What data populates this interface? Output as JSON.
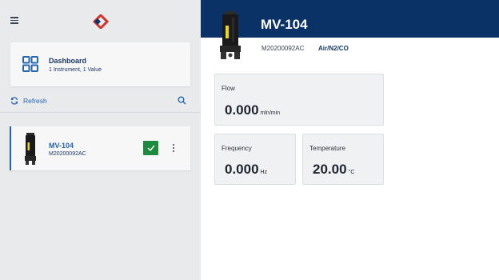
{
  "colors": {
    "brand_navy": "#0a3266",
    "accent_blue": "#2566b0",
    "logo_red": "#d0342c",
    "status_green": "#1e8a3d",
    "sidebar_bg": "#e9eaec"
  },
  "sidebar": {
    "menu_icon": "hamburger-icon",
    "logo_icon": "brand-logo-icon",
    "dashboard": {
      "icon": "grid-icon",
      "title": "Dashboard",
      "subtitle": "1 Instrument, 1 Value"
    },
    "refresh": {
      "icon": "refresh-icon",
      "label": "Refresh"
    },
    "search_icon": "search-icon",
    "instruments": [
      {
        "name": "MV-104",
        "serial": "M20200092AC",
        "status_icon": "checkmark-icon",
        "menu_icon": "kebab-icon"
      }
    ]
  },
  "main": {
    "device": {
      "title": "MV-104",
      "serial": "M20200092AC",
      "gas": "Air/N2/CO"
    },
    "tiles": {
      "flow": {
        "label": "Flow",
        "value": "0.000",
        "unit": "mln/min"
      },
      "frequency": {
        "label": "Frequency",
        "value": "0.000",
        "unit": "Hz"
      },
      "temperature": {
        "label": "Temperature",
        "value": "20.00",
        "unit": "°C"
      }
    }
  }
}
